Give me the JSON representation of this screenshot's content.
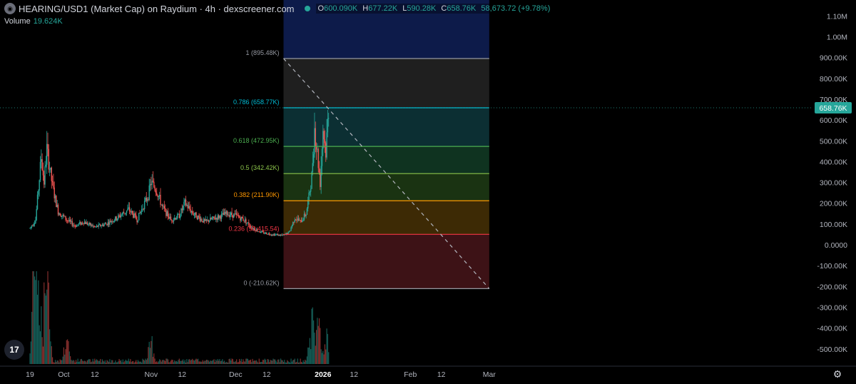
{
  "header": {
    "title": "HEARING/USD1 (Market Cap) on Raydium · 4h · dexscreener.com",
    "ohlc": [
      {
        "k": "O",
        "v": "600.090K"
      },
      {
        "k": "H",
        "v": "677.22K"
      },
      {
        "k": "L",
        "v": "590.28K"
      },
      {
        "k": "C",
        "v": "658.76K"
      },
      {
        "k": "",
        "v": "58,673.72 (+9.78%)"
      }
    ]
  },
  "volume": {
    "label": "Volume",
    "value": "19.624K"
  },
  "colors": {
    "up": "#26a69a",
    "down": "#ef5350",
    "background": "#000000",
    "fib_1": "#9598a1",
    "fib_0786": "#00bcd4",
    "fib_0618": "#4caf50",
    "fib_05": "#8bc34a",
    "fib_0382": "#ff9800",
    "fib_0236": "#f23645",
    "fib_0": "#9598a1"
  },
  "icons": {
    "logo": "tradingview-logo-icon",
    "settings": "gear-icon",
    "symbol": "coin-logo-icon"
  },
  "chart_data": {
    "type": "candlestick",
    "interval": "4h",
    "y_axis": {
      "ticks": [
        1100000,
        1000000,
        900000,
        800000,
        700000,
        600000,
        500000,
        400000,
        300000,
        200000,
        100000,
        0,
        -100000,
        -200000,
        -300000,
        -400000,
        -500000
      ],
      "tick_labels": [
        "1.10M",
        "1.00M",
        "900.00K",
        "800.00K",
        "700.00K",
        "600.00K",
        "500.00K",
        "400.00K",
        "300.00K",
        "200.00K",
        "100.00K",
        "0.0000",
        "-100.00K",
        "-200.00K",
        "-300.00K",
        "-400.00K",
        "-500.00K"
      ],
      "current_price": 658760,
      "current_label": "658.76K"
    },
    "x_axis": {
      "tick_labels": [
        "19",
        "Oct",
        "12",
        "Nov",
        "12",
        "Dec",
        "12",
        "2026",
        "12",
        "Feb",
        "12",
        "Mar"
      ],
      "tick_dates": [
        "2025-09-19",
        "2025-10-01",
        "2025-10-12",
        "2025-11-01",
        "2025-11-12",
        "2025-12-01",
        "2025-12-12",
        "2026-01-01",
        "2026-01-12",
        "2026-02-01",
        "2026-02-12",
        "2026-03-01"
      ]
    },
    "price_path": [
      [
        "2025-09-19",
        80000
      ],
      [
        "2025-09-21",
        120000
      ],
      [
        "2025-09-23",
        420000
      ],
      [
        "2025-09-24",
        300000
      ],
      [
        "2025-09-25",
        460000
      ],
      [
        "2025-09-27",
        280000
      ],
      [
        "2025-09-29",
        160000
      ],
      [
        "2025-10-02",
        120000
      ],
      [
        "2025-10-05",
        90000
      ],
      [
        "2025-10-08",
        110000
      ],
      [
        "2025-10-12",
        85000
      ],
      [
        "2025-10-16",
        100000
      ],
      [
        "2025-10-20",
        130000
      ],
      [
        "2025-10-24",
        170000
      ],
      [
        "2025-10-27",
        120000
      ],
      [
        "2025-10-31",
        240000
      ],
      [
        "2025-11-01",
        300000
      ],
      [
        "2025-11-03",
        260000
      ],
      [
        "2025-11-05",
        180000
      ],
      [
        "2025-11-08",
        120000
      ],
      [
        "2025-11-11",
        140000
      ],
      [
        "2025-11-13",
        200000
      ],
      [
        "2025-11-16",
        150000
      ],
      [
        "2025-11-20",
        110000
      ],
      [
        "2025-11-24",
        130000
      ],
      [
        "2025-11-28",
        150000
      ],
      [
        "2025-12-01",
        140000
      ],
      [
        "2025-12-04",
        120000
      ],
      [
        "2025-12-07",
        80000
      ],
      [
        "2025-12-10",
        60000
      ],
      [
        "2025-12-14",
        50000
      ],
      [
        "2025-12-18",
        45000
      ],
      [
        "2025-12-20",
        60000
      ],
      [
        "2025-12-22",
        130000
      ],
      [
        "2025-12-24",
        110000
      ],
      [
        "2025-12-26",
        150000
      ],
      [
        "2025-12-27",
        230000
      ],
      [
        "2025-12-28",
        330000
      ],
      [
        "2025-12-29",
        560000
      ],
      [
        "2025-12-30",
        440000
      ],
      [
        "2025-12-31",
        300000
      ],
      [
        "2026-01-01",
        560000
      ],
      [
        "2026-01-02",
        450000
      ],
      [
        "2026-01-03",
        658760
      ]
    ],
    "volume_peaks": [
      [
        "2025-09-21",
        180000
      ],
      [
        "2025-09-23",
        60000
      ],
      [
        "2025-09-25",
        120000
      ],
      [
        "2025-10-02",
        30000
      ],
      [
        "2025-11-01",
        25000
      ],
      [
        "2025-12-28",
        45000
      ],
      [
        "2025-12-30",
        60000
      ],
      [
        "2026-01-02",
        30000
      ]
    ],
    "fib": {
      "start": [
        "2025-12-18",
        895480
      ],
      "end": [
        "2026-02-29",
        -210620
      ],
      "levels": [
        {
          "ratio": "1",
          "value": 895480,
          "label": "1 (895.48K)",
          "color": "#9598a1"
        },
        {
          "ratio": "0.786",
          "value": 658770,
          "label": "0.786 (658.77K)",
          "color": "#00bcd4"
        },
        {
          "ratio": "0.618",
          "value": 472950,
          "label": "0.618 (472.95K)",
          "color": "#4caf50"
        },
        {
          "ratio": "0.5",
          "value": 342420,
          "label": "0.5 (342.42K)",
          "color": "#8bc34a"
        },
        {
          "ratio": "0.382",
          "value": 211900,
          "label": "0.382 (211.90K)",
          "color": "#ff9800"
        },
        {
          "ratio": "0.236",
          "value": 50415.54,
          "label": "0.236 (50,415.54)",
          "color": "#f23645"
        },
        {
          "ratio": "0",
          "value": -210620,
          "label": "0 (-210.62K)",
          "color": "#9598a1"
        }
      ]
    }
  }
}
